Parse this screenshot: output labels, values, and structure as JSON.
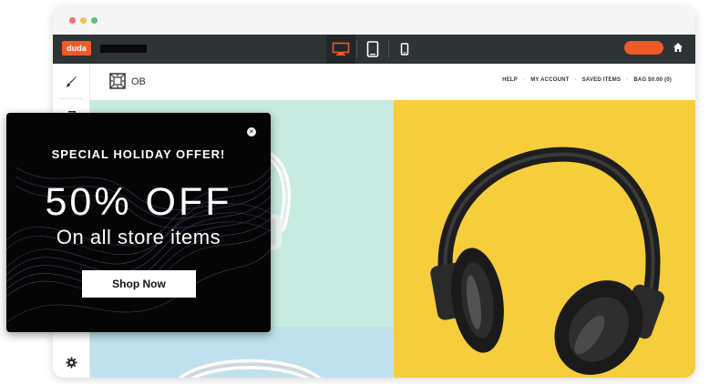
{
  "colors": {
    "accent": "#f05a28",
    "toolbar": "#2e3335",
    "dot_red": "#f1716c",
    "dot_yellow": "#f4c152",
    "dot_green": "#5fbf73",
    "mint": "#c7ebe0",
    "yellow": "#f6cd3a",
    "light_blue": "#bfe1ee"
  },
  "editor": {
    "logo_text": "duda",
    "site_name": "",
    "devices": [
      {
        "name": "desktop",
        "icon": "desktop-icon",
        "active": true
      },
      {
        "name": "tablet",
        "icon": "tablet-icon",
        "active": false
      },
      {
        "name": "mobile",
        "icon": "mobile-icon",
        "active": false
      }
    ],
    "publish_label": "",
    "home_icon": "home-icon",
    "sidebar_icons": [
      "brush-icon",
      "pages-icon",
      "settings-icon"
    ]
  },
  "site": {
    "logo_text": "OB",
    "nav": [
      "HELP",
      "MY ACCOUNT",
      "SAVED ITEMS",
      "BAG $0.00 (0)"
    ]
  },
  "popup": {
    "close_symbol": "×",
    "kicker": "SPECIAL HOLIDAY OFFER!",
    "headline": "50% OFF",
    "subheadline": "On all store items",
    "button_label": "Shop Now"
  }
}
